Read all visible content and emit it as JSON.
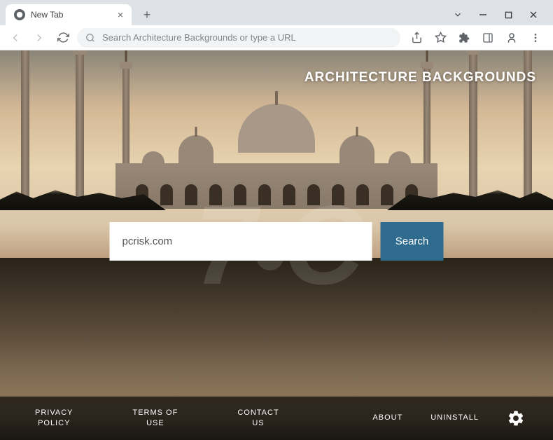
{
  "browser": {
    "tab_title": "New Tab",
    "omnibox_placeholder": "Search Architecture Backgrounds or type a URL"
  },
  "page": {
    "brand_title": "ARCHITECTURE BACKGROUNDS",
    "search_value": "pcrisk.com",
    "search_button": "Search"
  },
  "footer": {
    "privacy": "PRIVACY\nPOLICY",
    "terms": "TERMS OF\nUSE",
    "contact": "CONTACT\nUS",
    "about": "ABOUT",
    "uninstall": "UNINSTALL"
  },
  "watermark": "7●C"
}
